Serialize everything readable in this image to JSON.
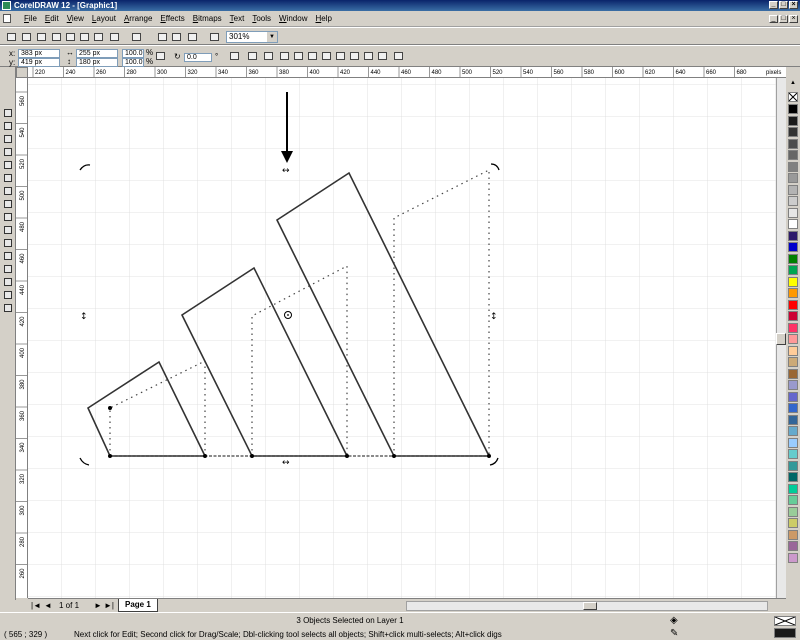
{
  "window": {
    "title": "CorelDRAW 12 - [Graphic1]"
  },
  "menu": {
    "items": [
      "File",
      "Edit",
      "View",
      "Layout",
      "Arrange",
      "Effects",
      "Bitmaps",
      "Text",
      "Tools",
      "Window",
      "Help"
    ]
  },
  "toolbar": {
    "zoom_value": "301%"
  },
  "property_bar": {
    "x_label": "x:",
    "x_value": "383 px",
    "y_label": "y:",
    "y_value": "419 px",
    "width_value": "255 px",
    "height_value": "180 px",
    "scale_x": "100.0",
    "scale_y": "100.0",
    "percent_sign": "%",
    "angle_value": "0.0",
    "degree_sign": "°"
  },
  "rulers": {
    "h_ticks": [
      "220",
      "240",
      "260",
      "280",
      "300",
      "320",
      "340",
      "360",
      "380",
      "400",
      "420",
      "440",
      "460",
      "480",
      "500",
      "520",
      "540",
      "560",
      "580",
      "600",
      "620",
      "640",
      "660",
      "680"
    ],
    "units": "pixels",
    "v_ticks": [
      "560",
      "540",
      "520",
      "500",
      "480",
      "460",
      "440",
      "420",
      "400",
      "380",
      "360",
      "340",
      "320",
      "300",
      "280",
      "260"
    ]
  },
  "page_nav": {
    "page_count": "1 of 1",
    "page_tab": "Page 1"
  },
  "status": {
    "selection_text": "3 Objects Selected on Layer 1",
    "coords": "( 565 ; 329 )",
    "hint": "Next click for Edit; Second click for Drag/Scale; Dbl-clicking tool selects all objects; Shift+click multi-selects; Alt+click digs"
  },
  "colors": {
    "title_start": "#0a246a",
    "title_end": "#3a6ea5",
    "chrome": "#d4d0c8",
    "palette": [
      "#000000",
      "#1a1a1a",
      "#333333",
      "#4d4d4d",
      "#666666",
      "#808080",
      "#999999",
      "#b3b3b3",
      "#cccccc",
      "#e6e6e6",
      "#ffffff",
      "#2e1a6b",
      "#0000cc",
      "#008000",
      "#00a651",
      "#ffff00",
      "#ff9900",
      "#ff0000",
      "#cc0033",
      "#ff3366",
      "#ff9999",
      "#ffcc99",
      "#ccaa77",
      "#996633",
      "#9999cc",
      "#6666cc",
      "#3366cc",
      "#336699",
      "#66aacc",
      "#99ccff",
      "#66cccc",
      "#339999",
      "#006666",
      "#00cc99",
      "#66cc99",
      "#99cc99",
      "#cccc66",
      "#cc9966",
      "#996699",
      "#cc99cc"
    ]
  }
}
